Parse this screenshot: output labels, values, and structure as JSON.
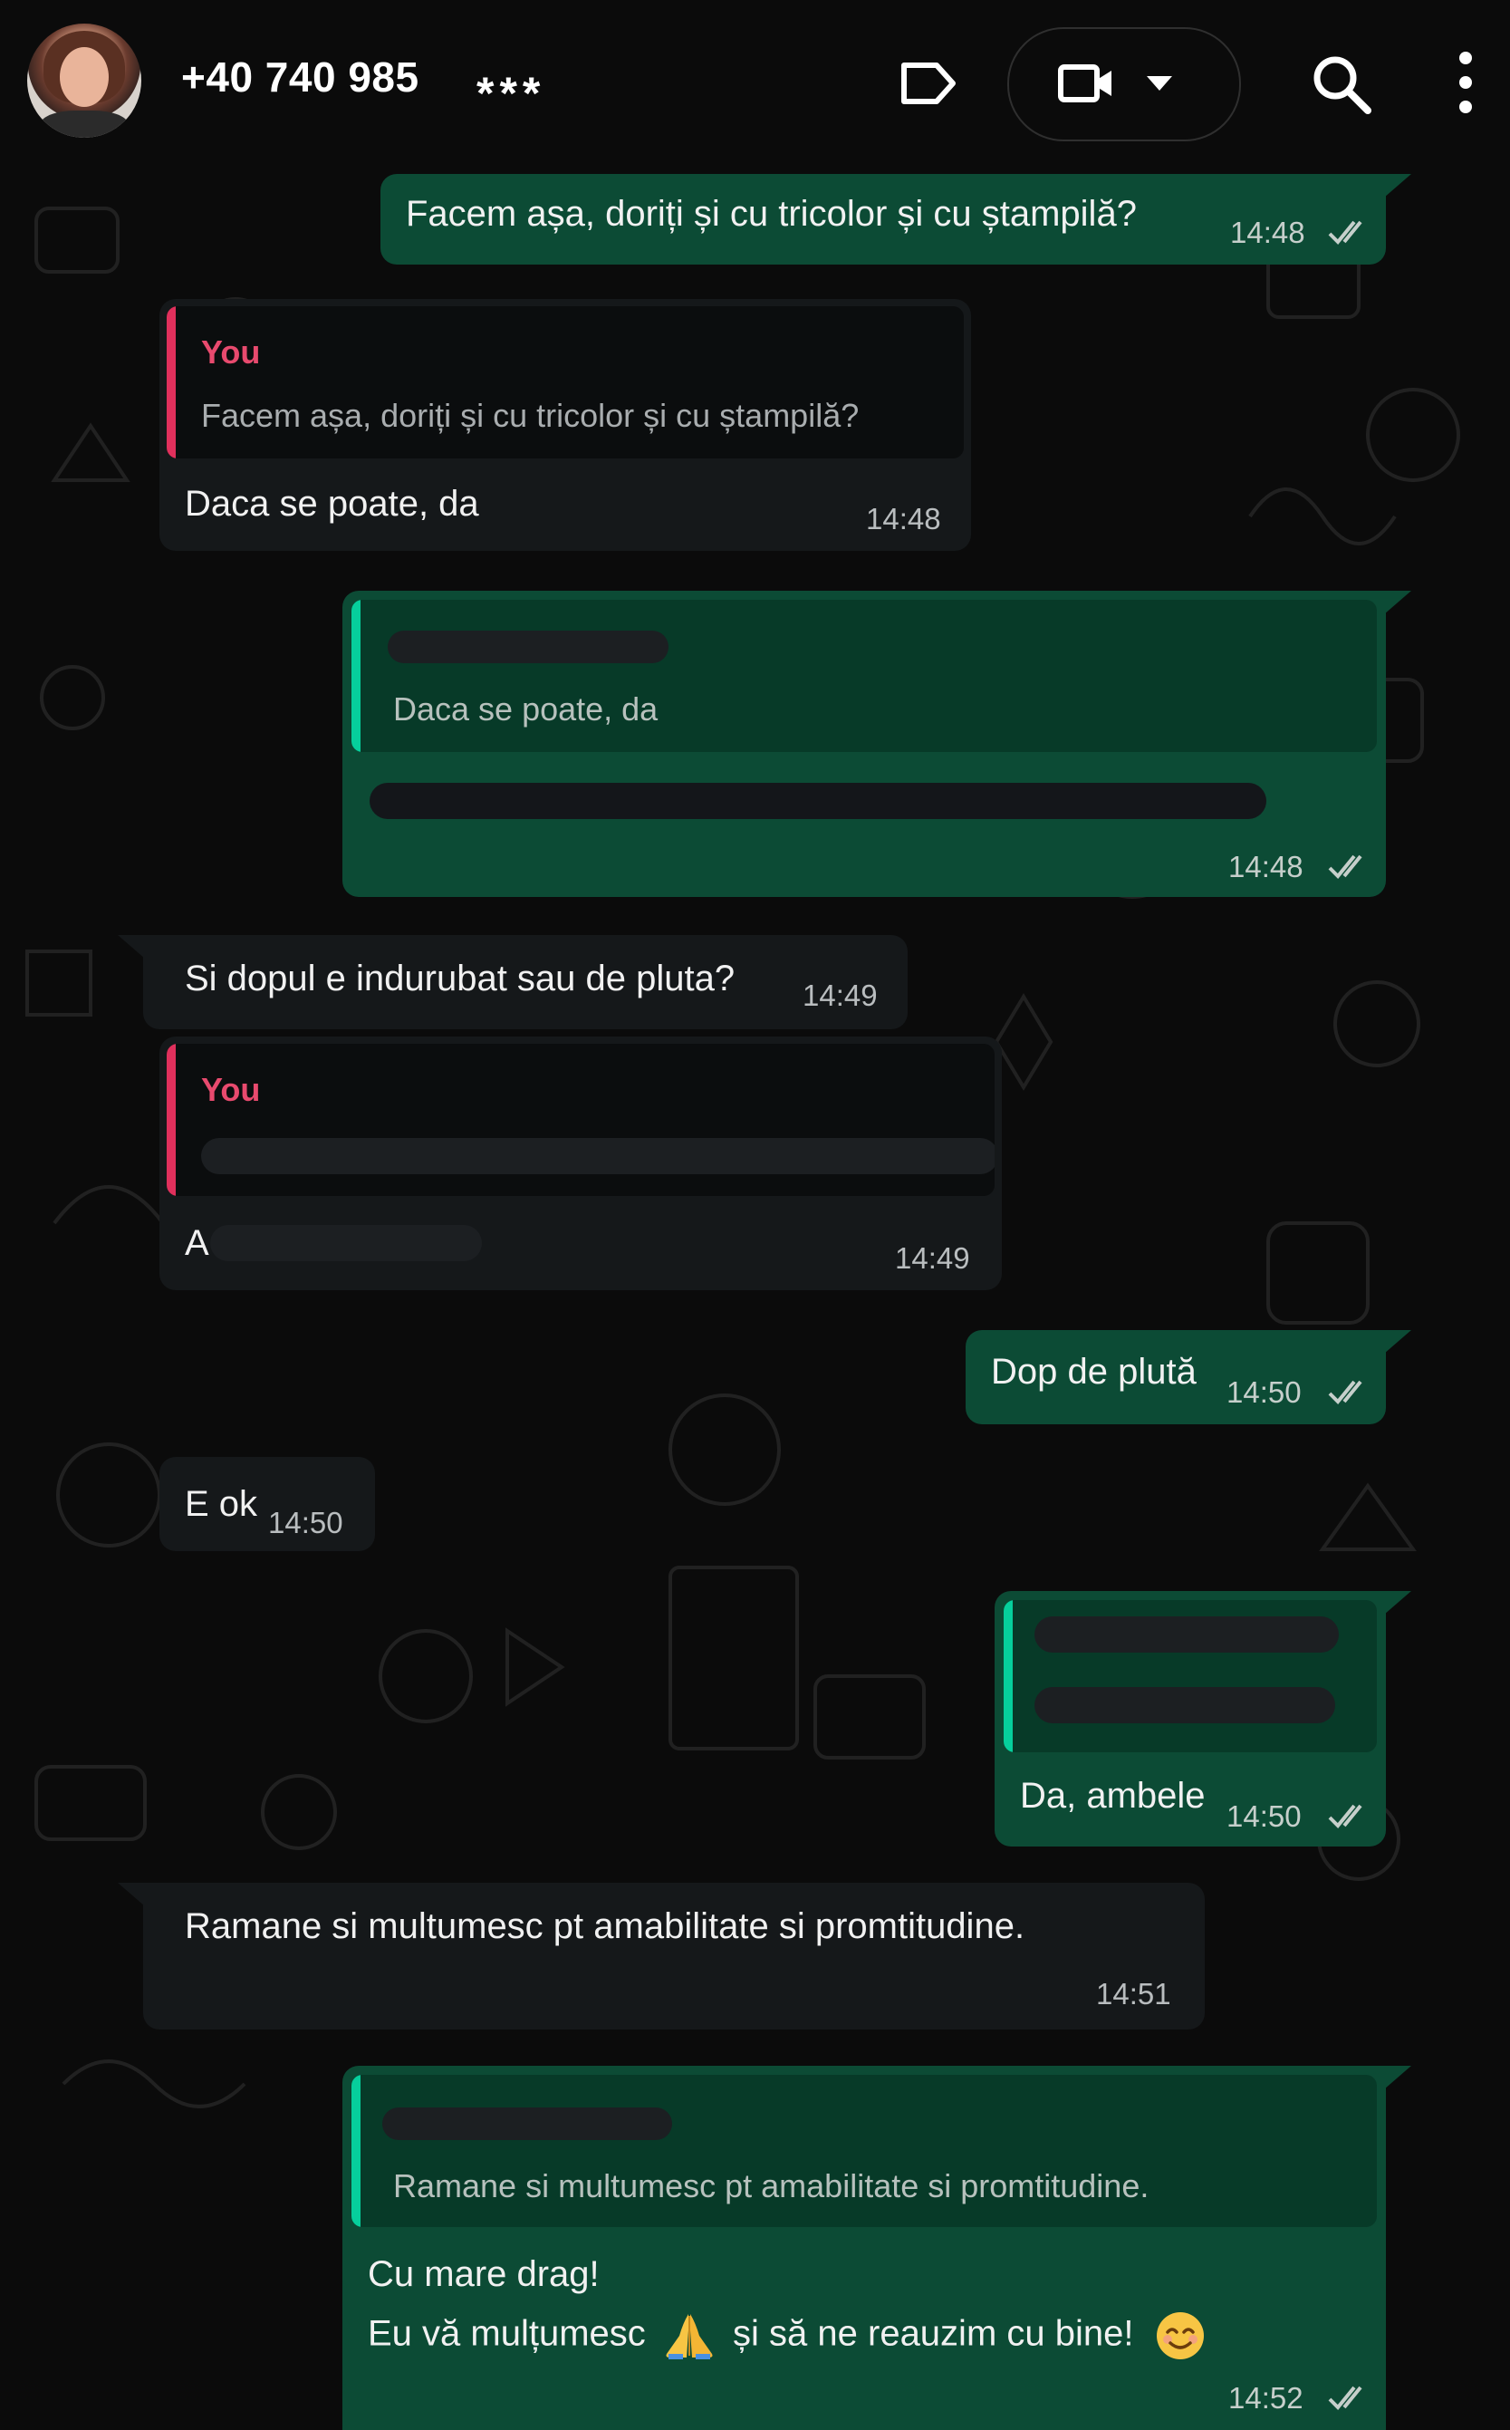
{
  "header": {
    "contact_name": "+40 740 985",
    "masked_suffix": "***"
  },
  "icons": {
    "label": "label-icon",
    "video": "video-camera-icon",
    "caret": "caret-down-icon",
    "search": "search-icon",
    "more": "more-vertical-icon",
    "read": "double-check-icon"
  },
  "colors": {
    "outgoing_bubble": "#0c4b35",
    "incoming_bubble": "#15181a",
    "quote_author": "#e84a6e",
    "quote_bar_out": "#06cf9c"
  },
  "messages": [
    {
      "dir": "out",
      "text": "Facem așa, doriți și cu tricolor și cu ștampilă?",
      "time": "14:48"
    },
    {
      "dir": "in",
      "quote_author": "You",
      "quote_text": "Facem așa, doriți și cu tricolor și cu ștampilă?",
      "text": "Daca se poate, da",
      "time": "14:48"
    },
    {
      "dir": "out",
      "quote_text": "Daca se poate, da",
      "time": "14:48"
    },
    {
      "dir": "in",
      "text": "Si dopul e indurubat sau de pluta?",
      "time": "14:49"
    },
    {
      "dir": "in",
      "quote_author": "You",
      "text": "A",
      "time": "14:49"
    },
    {
      "dir": "out",
      "text": "Dop de plută",
      "time": "14:50"
    },
    {
      "dir": "in",
      "text": "E ok",
      "time": "14:50"
    },
    {
      "dir": "out",
      "text": "Da, ambele",
      "time": "14:50"
    },
    {
      "dir": "in",
      "text": "Ramane si multumesc pt amabilitate si promtitudine.",
      "time": "14:51"
    },
    {
      "dir": "out",
      "quote_text": "Ramane si multumesc pt amabilitate si promtitudine.",
      "text_line1": "Cu mare drag!",
      "text_line2a": "Eu vă mulțumesc",
      "text_line2b": "și să ne reauzim cu bine!",
      "time": "14:52"
    }
  ]
}
